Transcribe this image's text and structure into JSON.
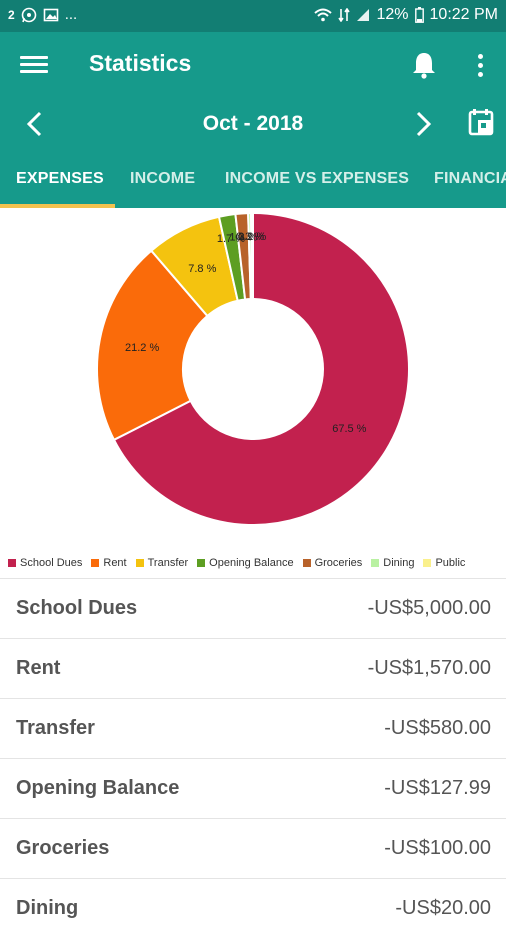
{
  "statusbar": {
    "left_icons": [
      "notification-count-icon",
      "whatsapp-icon",
      "image-icon",
      "more-dots"
    ],
    "left_count": "2",
    "left_dots": "...",
    "battery": "12%",
    "time": "10:22 PM"
  },
  "appbar": {
    "title": "Statistics",
    "menu_icon": "menu-icon",
    "bell_icon": "bell-icon",
    "more_icon": "more-vert-icon"
  },
  "period": {
    "label": "Oct - 2018",
    "prev_icon": "chevron-left-icon",
    "next_icon": "chevron-right-icon",
    "calendar_icon": "calendar-icon"
  },
  "tabs": [
    {
      "label": "EXPENSES",
      "active": true
    },
    {
      "label": "INCOME",
      "active": false
    },
    {
      "label": "INCOME VS EXPENSES",
      "active": false
    },
    {
      "label": "FINANCIAL",
      "active": false
    }
  ],
  "colors": {
    "primary": "#169a8b",
    "status_bar": "#127e73",
    "tab_indicator": "#f2c24f"
  },
  "chart_data": {
    "type": "pie",
    "style": "donut",
    "slices": [
      {
        "name": "School Dues",
        "value": 67.5,
        "label": "67.5 %",
        "color": "#c2214e"
      },
      {
        "name": "Rent",
        "value": 21.2,
        "label": "21.2 %",
        "color": "#fa6b0a"
      },
      {
        "name": "Transfer",
        "value": 7.8,
        "label": "7.8 %",
        "color": "#f4c30f"
      },
      {
        "name": "Opening Balance",
        "value": 1.7,
        "label": "1.7 %",
        "color": "#5d9e22"
      },
      {
        "name": "Groceries",
        "value": 1.3,
        "label": "1.3 %",
        "color": "#b8622a"
      },
      {
        "name": "Dining",
        "value": 0.3,
        "label": "0.3 %",
        "color": "#b9f1a2"
      },
      {
        "name": "Public",
        "value": 0.2,
        "label": "0.2 %",
        "color": "#faf08c"
      }
    ],
    "legend_position": "bottom"
  },
  "legend": [
    {
      "label": "School Dues",
      "color": "#c2214e"
    },
    {
      "label": "Rent",
      "color": "#fa6b0a"
    },
    {
      "label": "Transfer",
      "color": "#f4c30f"
    },
    {
      "label": "Opening Balance",
      "color": "#5d9e22"
    },
    {
      "label": "Groceries",
      "color": "#b8622a"
    },
    {
      "label": "Dining",
      "color": "#b9f1a2"
    },
    {
      "label": "Public",
      "color": "#faf08c"
    }
  ],
  "list": [
    {
      "name": "School Dues",
      "amount": "-US$5,000.00"
    },
    {
      "name": "Rent",
      "amount": "-US$1,570.00"
    },
    {
      "name": "Transfer",
      "amount": "-US$580.00"
    },
    {
      "name": "Opening Balance",
      "amount": "-US$127.99"
    },
    {
      "name": "Groceries",
      "amount": "-US$100.00"
    },
    {
      "name": "Dining",
      "amount": "-US$20.00"
    }
  ]
}
